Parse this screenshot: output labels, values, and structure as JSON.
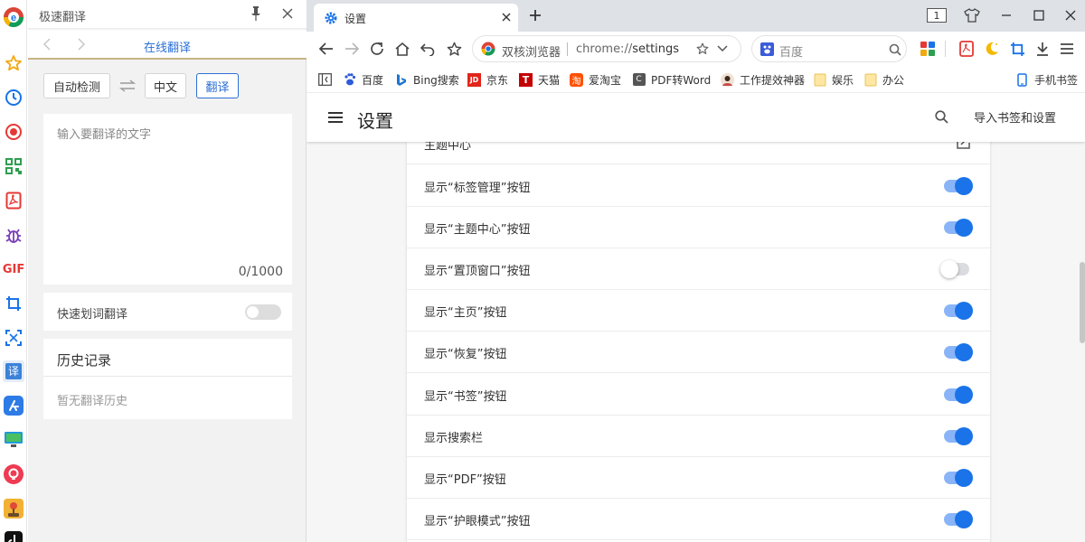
{
  "rail": {
    "icons": [
      "chrome-logo-icon",
      "star-icon",
      "clock-icon",
      "record-icon",
      "qr-code-icon",
      "pdf-icon",
      "bug-icon",
      "gif-icon",
      "crop-icon",
      "scan-icon",
      "translate-icon",
      "app-store-icon",
      "monitor-icon",
      "podcast-icon",
      "joystick-icon",
      "tiktok-icon"
    ],
    "gif_text": "GIF",
    "translate_glyph": "译"
  },
  "panel": {
    "title": "极速翻译",
    "nav_title": "在线翻译",
    "auto_detect": "自动检测",
    "target_lang": "中文",
    "translate_button": "翻译",
    "input_placeholder": "输入要翻译的文字",
    "char_count": "0/1000",
    "quick_translate_label": "快速划词翻译",
    "quick_translate_enabled": false,
    "history_title": "历史记录",
    "history_empty": "暂无翻译历史"
  },
  "browser": {
    "tab_title": "设置",
    "tab_count": "1",
    "omnibox": {
      "name": "双核浏览器",
      "url_proto": "chrome://",
      "url_path": "settings"
    },
    "search_placeholder": "百度",
    "bookmarks": [
      {
        "label": "",
        "icon": "sidebar-toggle-icon"
      },
      {
        "label": "百度",
        "icon": "baidu-icon"
      },
      {
        "label": "Bing搜索",
        "icon": "bing-icon"
      },
      {
        "label": "京东",
        "icon": "jd-icon"
      },
      {
        "label": "天猫",
        "icon": "tmall-icon"
      },
      {
        "label": "爱淘宝",
        "icon": "taobao-icon"
      },
      {
        "label": "PDF转Word",
        "icon": "pdf-convert-icon"
      },
      {
        "label": "工作提效神器",
        "icon": "avatar-icon"
      },
      {
        "label": "娱乐",
        "icon": "folder-icon"
      },
      {
        "label": "办公",
        "icon": "folder-icon"
      },
      {
        "label": "手机书签",
        "icon": "phone-icon"
      }
    ],
    "bookmark_glyphs": {
      "jd": "JD",
      "tmall": "T",
      "taobao": "淘",
      "pdf": "C"
    }
  },
  "settings": {
    "page_title": "设置",
    "import_label": "导入书签和设置",
    "rows": [
      {
        "label": "主题中心",
        "control": "link"
      },
      {
        "label": "显示“标签管理”按钮",
        "enabled": true
      },
      {
        "label": "显示“主题中心”按钮",
        "enabled": true
      },
      {
        "label": "显示“置顶窗口”按钮",
        "enabled": false
      },
      {
        "label": "显示“主页”按钮",
        "enabled": true
      },
      {
        "label": "显示“恢复”按钮",
        "enabled": true
      },
      {
        "label": "显示“书签”按钮",
        "enabled": true
      },
      {
        "label": "显示搜索栏",
        "enabled": true
      },
      {
        "label": "显示“PDF”按钮",
        "enabled": true
      },
      {
        "label": "显示“护眼模式”按钮",
        "enabled": true
      }
    ]
  },
  "colors": {
    "accent": "#1a73e8",
    "switch_track_on": "#8ab4f8",
    "panel_link": "#2b6fd6"
  }
}
